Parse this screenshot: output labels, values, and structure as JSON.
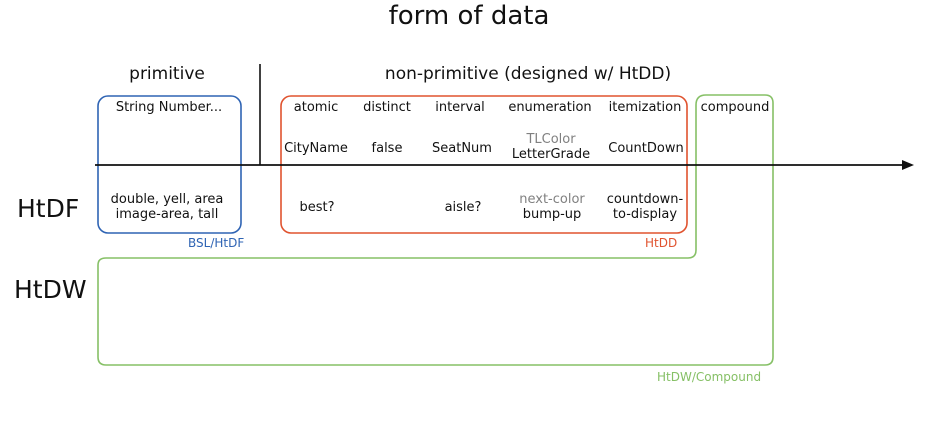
{
  "title": "form of data",
  "sections": {
    "primitive": "primitive",
    "non_primitive": "non-primitive (designed w/ HtDD)"
  },
  "categories": {
    "primitive_examples": "String Number...",
    "atomic": "atomic",
    "distinct": "distinct",
    "interval": "interval",
    "enumeration": "enumeration",
    "itemization": "itemization",
    "compound": "compound"
  },
  "data_examples": {
    "atomic": "CityName",
    "distinct": "false",
    "interval": "SeatNum",
    "enumeration_1": "TLColor",
    "enumeration_2": "LetterGrade",
    "itemization": "CountDown"
  },
  "function_examples": {
    "primitive_1": "double, yell, area",
    "primitive_2": "image-area, tall",
    "atomic": "best?",
    "interval": "aisle?",
    "enumeration_1": "next-color",
    "enumeration_2": "bump-up",
    "itemization_1": "countdown-",
    "itemization_2": "to-display"
  },
  "rows": {
    "htdf": "HtDF",
    "htdw": "HtDW"
  },
  "box_labels": {
    "bsl": "BSL/HtDF",
    "htdd": "HtDD",
    "htdw": "HtDW/Compound"
  },
  "colors": {
    "blue": "#2f64b4",
    "red": "#e0532f",
    "green": "#86c066",
    "gray": "#808080"
  }
}
